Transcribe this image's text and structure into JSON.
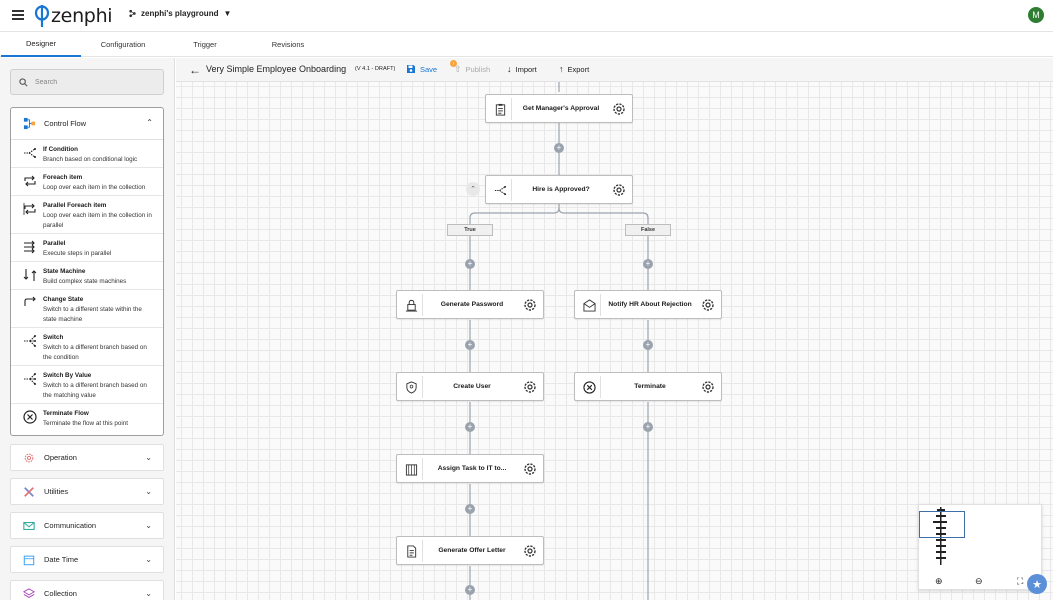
{
  "app": {
    "logo_text": "zenphi",
    "workspace": "zenphi's playground",
    "avatar_initial": "M"
  },
  "tabs": [
    {
      "label": "Designer"
    },
    {
      "label": "Configuration"
    },
    {
      "label": "Trigger"
    },
    {
      "label": "Revisions"
    }
  ],
  "sidebar": {
    "search_placeholder": "Search",
    "control_flow": {
      "title": "Control Flow",
      "items": [
        {
          "title": "If Condition",
          "desc": "Branch based on conditional logic"
        },
        {
          "title": "Foreach item",
          "desc": "Loop over each item in the collection"
        },
        {
          "title": "Parallel Foreach item",
          "desc": "Loop over each item in the collection in parallel"
        },
        {
          "title": "Parallel",
          "desc": "Execute steps in parallel"
        },
        {
          "title": "State Machine",
          "desc": "Build complex state machines"
        },
        {
          "title": "Change State",
          "desc": "Switch to a different state within the state machine"
        },
        {
          "title": "Switch",
          "desc": "Switch to a different branch based on the condition"
        },
        {
          "title": "Switch By Value",
          "desc": "Switch to a different branch based on the matching value"
        },
        {
          "title": "Terminate Flow",
          "desc": "Terminate the flow at this point"
        }
      ]
    },
    "categories": [
      {
        "label": "Operation"
      },
      {
        "label": "Utilities"
      },
      {
        "label": "Communication"
      },
      {
        "label": "Date Time"
      },
      {
        "label": "Collection"
      }
    ]
  },
  "toolbar": {
    "title": "Very Simple Employee Onboarding",
    "version": "(V 4.1 - DRAFT)",
    "save": "Save",
    "publish": "Publish",
    "publish_badge": "!",
    "import": "Import",
    "export": "Export"
  },
  "flow": {
    "nodes": [
      {
        "label": "Get Manager's Approval"
      },
      {
        "label": "Hire is Approved?"
      },
      {
        "label": "Generate Password"
      },
      {
        "label": "Notify HR About Rejection"
      },
      {
        "label": "Create User"
      },
      {
        "label": "Terminate"
      },
      {
        "label": "Assign Task to IT to..."
      },
      {
        "label": "Generate Offer Letter"
      }
    ],
    "branches": {
      "true_label": "True",
      "false_label": "False"
    }
  },
  "colors": {
    "accent": "#1976d2",
    "avatar": "#2e7d32",
    "badge": "#f7a440",
    "connector": "#9aa3ad"
  }
}
